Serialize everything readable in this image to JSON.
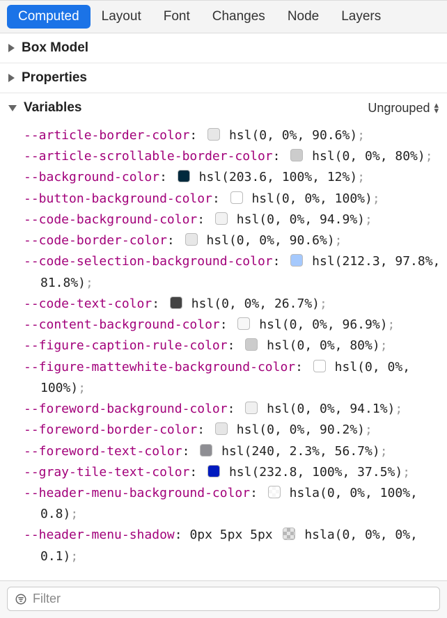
{
  "tabs": [
    {
      "label": "Computed",
      "active": true
    },
    {
      "label": "Layout",
      "active": false
    },
    {
      "label": "Font",
      "active": false
    },
    {
      "label": "Changes",
      "active": false
    },
    {
      "label": "Node",
      "active": false
    },
    {
      "label": "Layers",
      "active": false
    }
  ],
  "sections": {
    "boxmodel": {
      "title": "Box Model",
      "expanded": false
    },
    "properties": {
      "title": "Properties",
      "expanded": false
    },
    "variables": {
      "title": "Variables",
      "expanded": true,
      "grouping_label": "Ungrouped"
    }
  },
  "variables": [
    {
      "name": "--article-border-color",
      "swatch": "#e7e7e7",
      "value": "hsl(0, 0%, 90.6%)"
    },
    {
      "name": "--article-scrollable-border-color",
      "swatch": "#cccccc",
      "value": "hsl(0, 0%, 80%)"
    },
    {
      "name": "--background-color",
      "swatch": "#00293d",
      "value": "hsl(203.6, 100%, 12%)"
    },
    {
      "name": "--button-background-color",
      "swatch": "#ffffff",
      "value": "hsl(0, 0%, 100%)"
    },
    {
      "name": "--code-background-color",
      "swatch": "#f2f2f2",
      "value": "hsl(0, 0%, 94.9%)"
    },
    {
      "name": "--code-border-color",
      "swatch": "#e7e7e7",
      "value": "hsl(0, 0%, 90.6%)"
    },
    {
      "name": "--code-selection-background-color",
      "swatch": "#a5c9fd",
      "value": "hsl(212.3, 97.8%, 81.8%)"
    },
    {
      "name": "--code-text-color",
      "swatch": "#444444",
      "value": "hsl(0, 0%, 26.7%)"
    },
    {
      "name": "--content-background-color",
      "swatch": "#f7f7f7",
      "value": "hsl(0, 0%, 96.9%)"
    },
    {
      "name": "--figure-caption-rule-color",
      "swatch": "#cccccc",
      "value": "hsl(0, 0%, 80%)"
    },
    {
      "name": "--figure-mattewhite-background-color",
      "swatch": "#ffffff",
      "value": "hsl(0, 0%, 100%)"
    },
    {
      "name": "--foreword-background-color",
      "swatch": "#f0f0f0",
      "value": "hsl(0, 0%, 94.1%)"
    },
    {
      "name": "--foreword-border-color",
      "swatch": "#e6e6e6",
      "value": "hsl(0, 0%, 90.2%)"
    },
    {
      "name": "--foreword-text-color",
      "swatch": "#8e8e93",
      "value": "hsl(240, 2.3%, 56.7%)"
    },
    {
      "name": "--gray-tile-text-color",
      "swatch": "#001abf",
      "value": "hsl(232.8, 100%, 37.5%)"
    },
    {
      "name": "--header-menu-background-color",
      "swatch": "rgba(255,255,255,0.8)",
      "checker": true,
      "value": "hsla(0, 0%, 100%, 0.8)"
    },
    {
      "name": "--header-menu-shadow",
      "prefix": "0px 5px 5px ",
      "swatch": "rgba(0,0,0,0.1)",
      "checker": true,
      "value": "hsla(0, 0%, 0%, 0.1)"
    }
  ],
  "filter": {
    "placeholder": "Filter",
    "value": ""
  }
}
